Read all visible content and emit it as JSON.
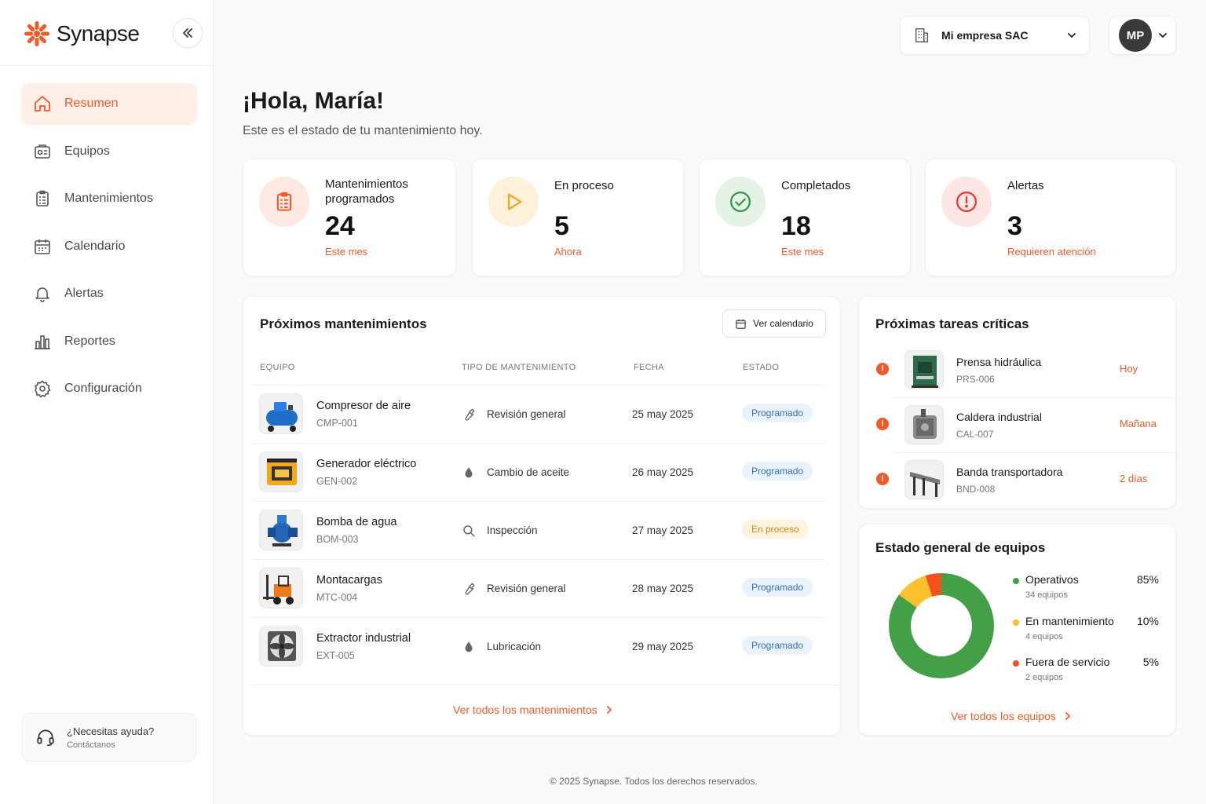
{
  "brand": {
    "name": "Synapse",
    "accent": "#f05a28"
  },
  "sidebar": {
    "items": [
      {
        "label": "Resumen",
        "icon": "home-icon",
        "active": true
      },
      {
        "label": "Equipos",
        "icon": "equipment-icon"
      },
      {
        "label": "Mantenimientos",
        "icon": "clipboard-icon"
      },
      {
        "label": "Calendario",
        "icon": "calendar-icon"
      },
      {
        "label": "Alertas",
        "icon": "bell-icon"
      },
      {
        "label": "Reportes",
        "icon": "bar-chart-icon"
      },
      {
        "label": "Configuración",
        "icon": "gear-icon"
      }
    ],
    "help": {
      "title": "¿Necesitas ayuda?",
      "subtitle": "Contáctanos"
    }
  },
  "topbar": {
    "company": "Mi empresa SAC",
    "user_initials": "MP"
  },
  "header": {
    "greeting": "¡Hola, María!",
    "subtitle": "Este es el estado de tu mantenimiento hoy."
  },
  "stats": [
    {
      "title": "Mantenimientos programados",
      "value": "24",
      "sub": "Este mes"
    },
    {
      "title": "En proceso",
      "value": "5",
      "sub": "Ahora"
    },
    {
      "title": "Completados",
      "value": "18",
      "sub": "Este mes"
    },
    {
      "title": "Alertas",
      "value": "3",
      "sub": "Requieren atención"
    }
  ],
  "upcoming": {
    "title": "Próximos mantenimientos",
    "calendar_button": "Ver calendario",
    "columns": [
      "EQUIPO",
      "TIPO DE MANTENIMIENTO",
      "FECHA",
      "ESTADO"
    ],
    "rows": [
      {
        "name": "Compresor de aire",
        "code": "CMP-001",
        "type": "Revisión general",
        "type_icon": "wrench-icon",
        "date": "25 may 2025",
        "status": "Programado"
      },
      {
        "name": "Generador eléctrico",
        "code": "GEN-002",
        "type": "Cambio de aceite",
        "type_icon": "drop-icon",
        "date": "26 may 2025",
        "status": "Programado"
      },
      {
        "name": "Bomba de agua",
        "code": "BOM-003",
        "type": "Inspección",
        "type_icon": "search-icon",
        "date": "27 may 2025",
        "status": "En proceso"
      },
      {
        "name": "Montacargas",
        "code": "MTC-004",
        "type": "Revisión general",
        "type_icon": "wrench-icon",
        "date": "28 may 2025",
        "status": "Programado"
      },
      {
        "name": "Extractor industrial",
        "code": "EXT-005",
        "type": "Lubricación",
        "type_icon": "drop-icon",
        "date": "29 may 2025",
        "status": "Programado"
      }
    ],
    "view_all": "Ver todos los mantenimientos"
  },
  "critical": {
    "title": "Próximas tareas críticas",
    "tasks": [
      {
        "name": "Prensa hidráulica",
        "code": "PRS-006",
        "when": "Hoy"
      },
      {
        "name": "Caldera industrial",
        "code": "CAL-007",
        "when": "Mañana"
      },
      {
        "name": "Banda transportadora",
        "code": "BND-008",
        "when": "2 días"
      }
    ]
  },
  "equipment_status": {
    "title": "Estado general de equipos",
    "items": [
      {
        "name": "Operativos",
        "count": "34 equipos",
        "pct": "85%",
        "value": 85,
        "color": "#43a047"
      },
      {
        "name": "En mantenimiento",
        "count": "4 equipos",
        "pct": "10%",
        "value": 10,
        "color": "#fbc02d"
      },
      {
        "name": "Fuera de servicio",
        "count": "2 equipos",
        "pct": "5%",
        "value": 5,
        "color": "#f4511e"
      }
    ],
    "view_all": "Ver todos los equipos"
  },
  "footer": "© 2025 Synapse. Todos los derechos reservados."
}
